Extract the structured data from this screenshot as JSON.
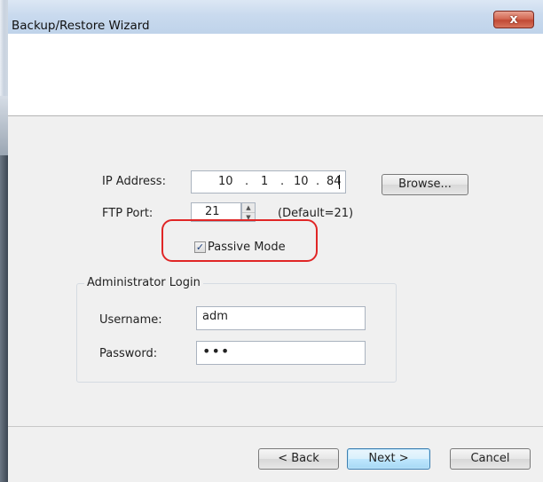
{
  "window": {
    "title": "Backup/Restore Wizard",
    "close_glyph": "x"
  },
  "form": {
    "ip_label": "IP Address:",
    "ip": [
      "10",
      "1",
      "10",
      "84"
    ],
    "ip_separator": ".",
    "browse_label": "Browse...",
    "ftp_port_label": "FTP Port:",
    "ftp_port_value": "21",
    "ftp_default_text": "(Default=21)",
    "passive_mode_label": "Passive Mode",
    "passive_mode_checked": true
  },
  "admin_login": {
    "group_title": "Administrator Login",
    "username_label": "Username:",
    "username_value": "adm",
    "password_label": "Password:",
    "password_mask": "•••"
  },
  "buttons": {
    "back": "< Back",
    "next": "Next >",
    "cancel": "Cancel"
  },
  "colors": {
    "highlight": "#e02626",
    "close_button": "#c14a35",
    "default_button_border": "#3c7fb1"
  }
}
